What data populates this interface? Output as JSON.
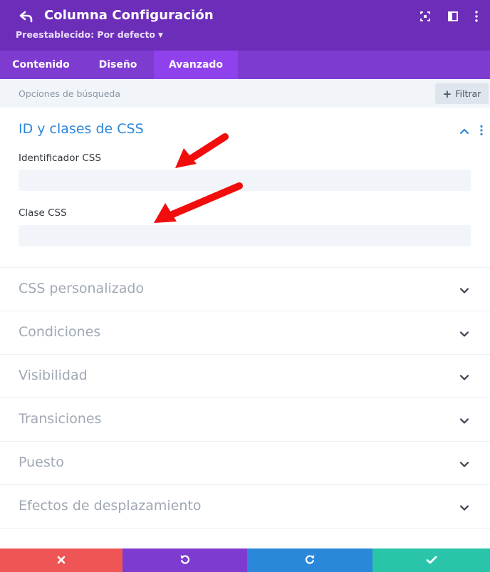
{
  "header": {
    "title": "Columna Configuración",
    "preset": "Preestablecido: Por defecto",
    "icons": [
      "back-arrow-icon",
      "expand-icon",
      "sidebar-layout-icon",
      "more-vertical-icon"
    ]
  },
  "tabs": [
    {
      "label": "Contenido",
      "active": false
    },
    {
      "label": "Diseño",
      "active": false
    },
    {
      "label": "Avanzado",
      "active": true
    }
  ],
  "search": {
    "placeholder": "Opciones de búsqueda",
    "filter_label": "Filtrar"
  },
  "open_section": {
    "title": "ID y clases de CSS",
    "fields": [
      {
        "label": "Identificador CSS",
        "value": ""
      },
      {
        "label": "Clase CSS",
        "value": ""
      }
    ]
  },
  "sections": [
    {
      "title": "CSS personalizado"
    },
    {
      "title": "Condiciones"
    },
    {
      "title": "Visibilidad"
    },
    {
      "title": "Transiciones"
    },
    {
      "title": "Puesto"
    },
    {
      "title": "Efectos de desplazamiento"
    }
  ],
  "footer": {
    "buttons": [
      "discard-icon",
      "undo-icon",
      "redo-icon",
      "save-icon"
    ]
  },
  "colors": {
    "header_bg": "#6c2eb9",
    "tabs_bg": "#7e3bd0",
    "active_tab": "#8f42ec",
    "open_title": "#2b87da",
    "section_title": "#a0a8b5",
    "annotation_arrow": "#f20d0d",
    "discard": "#ef5555",
    "undo": "#7e3bd0",
    "redo": "#2b87da",
    "save": "#29c4a9"
  }
}
